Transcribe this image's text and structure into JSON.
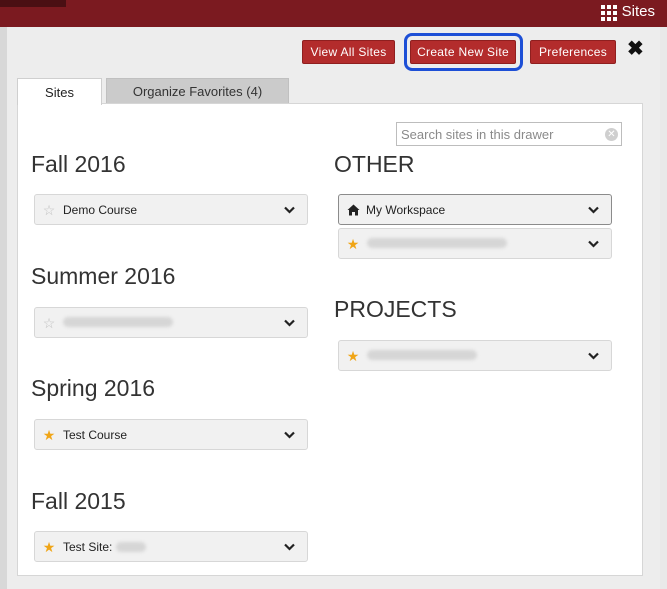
{
  "topbar": {
    "sites_label": "Sites"
  },
  "toolbar": {
    "view_all_label": "View All Sites",
    "create_label": "Create New Site",
    "preferences_label": "Preferences",
    "close_glyph": "✖"
  },
  "tabs": [
    {
      "label": "Sites",
      "active": true
    },
    {
      "label": "Organize Favorites (4)",
      "active": false
    }
  ],
  "search": {
    "placeholder": "Search sites in this drawer",
    "value": ""
  },
  "groups": [
    {
      "heading": "Fall 2016",
      "sites": [
        {
          "label": "Demo Course",
          "favorite": false
        }
      ]
    },
    {
      "heading": "Summer 2016",
      "sites": [
        {
          "label": "",
          "favorite": false
        }
      ]
    },
    {
      "heading": "Spring 2016",
      "sites": [
        {
          "label": "Test Course",
          "favorite": true
        }
      ]
    },
    {
      "heading": "Fall 2015",
      "sites": [
        {
          "label": "Test Site:",
          "favorite": true
        }
      ]
    },
    {
      "heading": "OTHER",
      "sites": [
        {
          "label": "My Workspace",
          "icon": "home-icon"
        },
        {
          "label": "",
          "favorite": true
        }
      ]
    },
    {
      "heading": "PROJECTS",
      "sites": [
        {
          "label": "",
          "favorite": true
        }
      ]
    }
  ],
  "icons": {
    "star_on": "★",
    "star_off": "☆"
  },
  "colors": {
    "brand": "#7b1a20",
    "button": "#b32c2c",
    "highlight": "#1d4fd6",
    "star": "#f0a516"
  }
}
